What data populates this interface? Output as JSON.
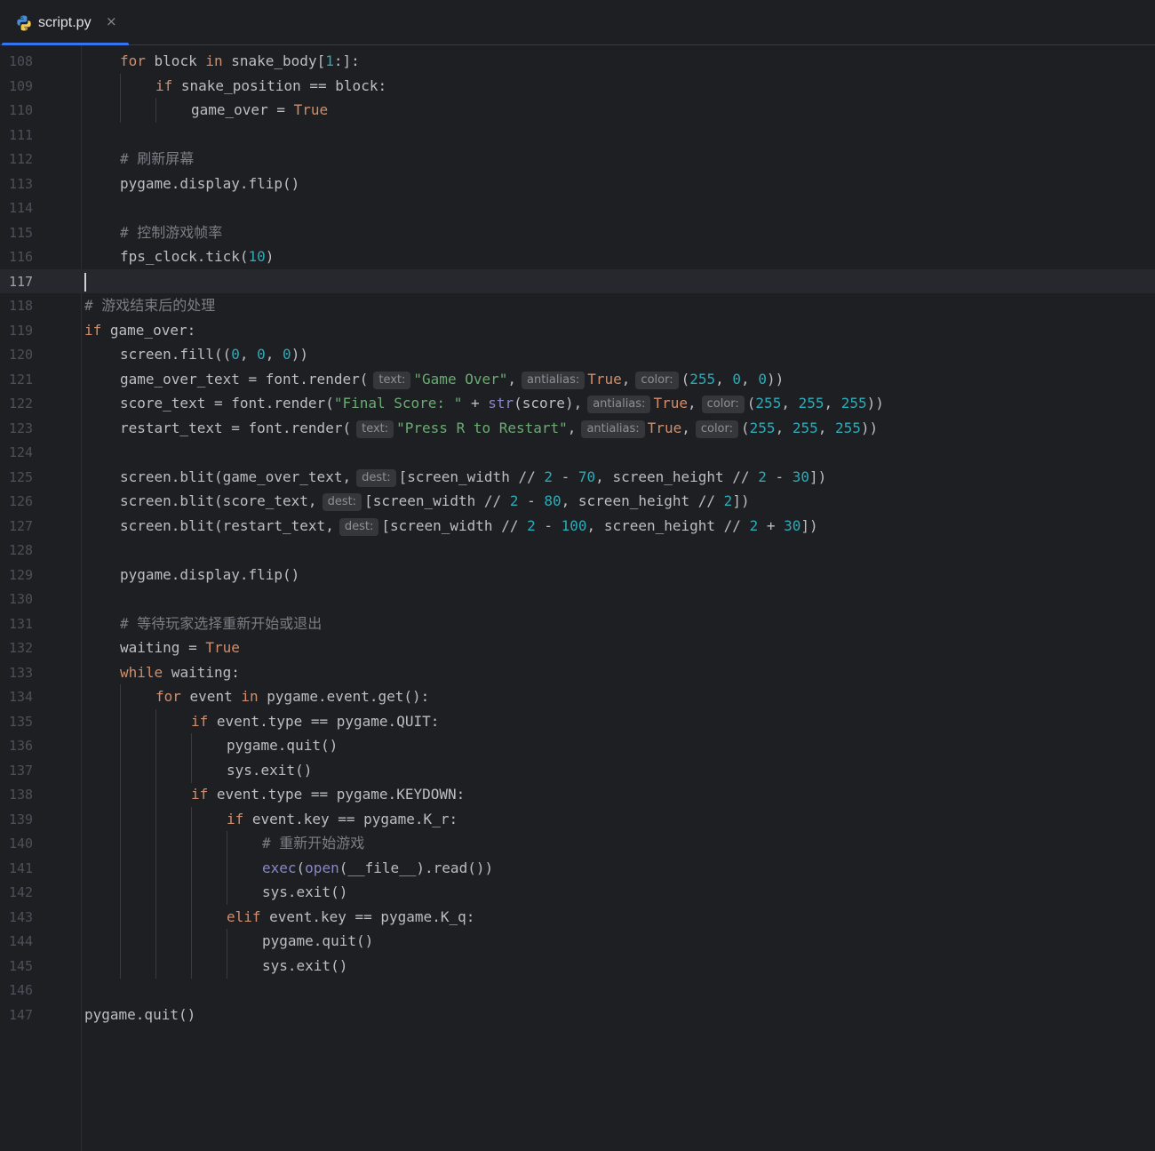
{
  "tab": {
    "filename": "script.py",
    "close_glyph": "×",
    "icon": "python-file-icon"
  },
  "editor": {
    "current_line": 117,
    "lines": [
      {
        "n": "108",
        "indent": 1,
        "t": [
          [
            "kw",
            "for"
          ],
          [
            "p",
            " block "
          ],
          [
            "kw",
            "in"
          ],
          [
            "p",
            " snake_body["
          ],
          [
            "num",
            "1"
          ],
          [
            "p",
            ":]:"
          ]
        ]
      },
      {
        "n": "109",
        "indent": 2,
        "t": [
          [
            "kw",
            "if"
          ],
          [
            "p",
            " snake_position == block:"
          ]
        ]
      },
      {
        "n": "110",
        "indent": 3,
        "t": [
          [
            "p",
            "game_over = "
          ],
          [
            "kw",
            "True"
          ]
        ]
      },
      {
        "n": "111",
        "indent": 0,
        "t": []
      },
      {
        "n": "112",
        "indent": 1,
        "t": [
          [
            "cm",
            "# 刷新屏幕"
          ]
        ]
      },
      {
        "n": "113",
        "indent": 1,
        "t": [
          [
            "p",
            "pygame.display.flip()"
          ]
        ]
      },
      {
        "n": "114",
        "indent": 0,
        "t": []
      },
      {
        "n": "115",
        "indent": 1,
        "t": [
          [
            "cm",
            "# 控制游戏帧率"
          ]
        ]
      },
      {
        "n": "116",
        "indent": 1,
        "t": [
          [
            "p",
            "fps_clock.tick("
          ],
          [
            "num",
            "10"
          ],
          [
            "p",
            ")"
          ]
        ]
      },
      {
        "n": "117",
        "indent": 0,
        "t": []
      },
      {
        "n": "118",
        "indent": 0,
        "t": [
          [
            "cm",
            "# 游戏结束后的处理"
          ]
        ]
      },
      {
        "n": "119",
        "indent": 0,
        "t": [
          [
            "kw",
            "if"
          ],
          [
            "p",
            " game_over:"
          ]
        ]
      },
      {
        "n": "120",
        "indent": 1,
        "t": [
          [
            "p",
            "screen.fill(("
          ],
          [
            "num",
            "0"
          ],
          [
            "p",
            ", "
          ],
          [
            "num",
            "0"
          ],
          [
            "p",
            ", "
          ],
          [
            "num",
            "0"
          ],
          [
            "p",
            "))"
          ]
        ]
      },
      {
        "n": "121",
        "indent": 1,
        "t": [
          [
            "p",
            "game_over_text = font.render("
          ],
          [
            "hint",
            "text:"
          ],
          [
            "str",
            "\"Game Over\""
          ],
          [
            "p",
            ","
          ],
          [
            "hint",
            "antialias:"
          ],
          [
            "kw",
            "True"
          ],
          [
            "p",
            ","
          ],
          [
            "hint",
            "color:"
          ],
          [
            "p",
            "("
          ],
          [
            "num",
            "255"
          ],
          [
            "p",
            ", "
          ],
          [
            "num",
            "0"
          ],
          [
            "p",
            ", "
          ],
          [
            "num",
            "0"
          ],
          [
            "p",
            "))"
          ]
        ]
      },
      {
        "n": "122",
        "indent": 1,
        "t": [
          [
            "p",
            "score_text = font.render("
          ],
          [
            "str",
            "\"Final Score: \""
          ],
          [
            "p",
            " + "
          ],
          [
            "bi",
            "str"
          ],
          [
            "p",
            "(score),"
          ],
          [
            "hint",
            "antialias:"
          ],
          [
            "kw",
            "True"
          ],
          [
            "p",
            ","
          ],
          [
            "hint",
            "color:"
          ],
          [
            "p",
            "("
          ],
          [
            "num",
            "255"
          ],
          [
            "p",
            ", "
          ],
          [
            "num",
            "255"
          ],
          [
            "p",
            ", "
          ],
          [
            "num",
            "255"
          ],
          [
            "p",
            "))"
          ]
        ]
      },
      {
        "n": "123",
        "indent": 1,
        "t": [
          [
            "p",
            "restart_text = font.render("
          ],
          [
            "hint",
            "text:"
          ],
          [
            "str",
            "\"Press R to Restart\""
          ],
          [
            "p",
            ","
          ],
          [
            "hint",
            "antialias:"
          ],
          [
            "kw",
            "True"
          ],
          [
            "p",
            ","
          ],
          [
            "hint",
            "color:"
          ],
          [
            "p",
            "("
          ],
          [
            "num",
            "255"
          ],
          [
            "p",
            ", "
          ],
          [
            "num",
            "255"
          ],
          [
            "p",
            ", "
          ],
          [
            "num",
            "255"
          ],
          [
            "p",
            "))"
          ]
        ]
      },
      {
        "n": "124",
        "indent": 0,
        "t": []
      },
      {
        "n": "125",
        "indent": 1,
        "t": [
          [
            "p",
            "screen.blit(game_over_text,"
          ],
          [
            "hint",
            "dest:"
          ],
          [
            "p",
            "[screen_width // "
          ],
          [
            "num",
            "2"
          ],
          [
            "p",
            " - "
          ],
          [
            "num",
            "70"
          ],
          [
            "p",
            ", screen_height // "
          ],
          [
            "num",
            "2"
          ],
          [
            "p",
            " - "
          ],
          [
            "num",
            "30"
          ],
          [
            "p",
            "])"
          ]
        ]
      },
      {
        "n": "126",
        "indent": 1,
        "t": [
          [
            "p",
            "screen.blit(score_text,"
          ],
          [
            "hint",
            "dest:"
          ],
          [
            "p",
            "[screen_width // "
          ],
          [
            "num",
            "2"
          ],
          [
            "p",
            " - "
          ],
          [
            "num",
            "80"
          ],
          [
            "p",
            ", screen_height // "
          ],
          [
            "num",
            "2"
          ],
          [
            "p",
            "])"
          ]
        ]
      },
      {
        "n": "127",
        "indent": 1,
        "t": [
          [
            "p",
            "screen.blit(restart_text,"
          ],
          [
            "hint",
            "dest:"
          ],
          [
            "p",
            "[screen_width // "
          ],
          [
            "num",
            "2"
          ],
          [
            "p",
            " - "
          ],
          [
            "num",
            "100"
          ],
          [
            "p",
            ", screen_height // "
          ],
          [
            "num",
            "2"
          ],
          [
            "p",
            " + "
          ],
          [
            "num",
            "30"
          ],
          [
            "p",
            "])"
          ]
        ]
      },
      {
        "n": "128",
        "indent": 0,
        "t": []
      },
      {
        "n": "129",
        "indent": 1,
        "t": [
          [
            "p",
            "pygame.display.flip()"
          ]
        ]
      },
      {
        "n": "130",
        "indent": 0,
        "t": []
      },
      {
        "n": "131",
        "indent": 1,
        "t": [
          [
            "cm",
            "# 等待玩家选择重新开始或退出"
          ]
        ]
      },
      {
        "n": "132",
        "indent": 1,
        "t": [
          [
            "p",
            "waiting = "
          ],
          [
            "kw",
            "True"
          ]
        ]
      },
      {
        "n": "133",
        "indent": 1,
        "t": [
          [
            "kw",
            "while"
          ],
          [
            "p",
            " waiting:"
          ]
        ]
      },
      {
        "n": "134",
        "indent": 2,
        "t": [
          [
            "kw",
            "for"
          ],
          [
            "p",
            " event "
          ],
          [
            "kw",
            "in"
          ],
          [
            "p",
            " pygame.event.get():"
          ]
        ]
      },
      {
        "n": "135",
        "indent": 3,
        "t": [
          [
            "kw",
            "if"
          ],
          [
            "p",
            " event.type == pygame.QUIT:"
          ]
        ]
      },
      {
        "n": "136",
        "indent": 4,
        "t": [
          [
            "p",
            "pygame.quit()"
          ]
        ]
      },
      {
        "n": "137",
        "indent": 4,
        "t": [
          [
            "p",
            "sys.exit()"
          ]
        ]
      },
      {
        "n": "138",
        "indent": 3,
        "t": [
          [
            "kw",
            "if"
          ],
          [
            "p",
            " event.type == pygame.KEYDOWN:"
          ]
        ]
      },
      {
        "n": "139",
        "indent": 4,
        "t": [
          [
            "kw",
            "if"
          ],
          [
            "p",
            " event.key == pygame.K_r:"
          ]
        ]
      },
      {
        "n": "140",
        "indent": 5,
        "t": [
          [
            "cm",
            "# 重新开始游戏"
          ]
        ]
      },
      {
        "n": "141",
        "indent": 5,
        "t": [
          [
            "bi",
            "exec"
          ],
          [
            "p",
            "("
          ],
          [
            "bi",
            "open"
          ],
          [
            "p",
            "(__file__).read())"
          ]
        ]
      },
      {
        "n": "142",
        "indent": 5,
        "t": [
          [
            "p",
            "sys.exit()"
          ]
        ]
      },
      {
        "n": "143",
        "indent": 4,
        "t": [
          [
            "kw",
            "elif"
          ],
          [
            "p",
            " event.key == pygame.K_q:"
          ]
        ]
      },
      {
        "n": "144",
        "indent": 5,
        "t": [
          [
            "p",
            "pygame.quit()"
          ]
        ]
      },
      {
        "n": "145",
        "indent": 5,
        "t": [
          [
            "p",
            "sys.exit()"
          ]
        ]
      },
      {
        "n": "146",
        "indent": 0,
        "t": []
      },
      {
        "n": "147",
        "indent": 0,
        "t": [
          [
            "p",
            "pygame.quit()"
          ]
        ]
      }
    ]
  }
}
